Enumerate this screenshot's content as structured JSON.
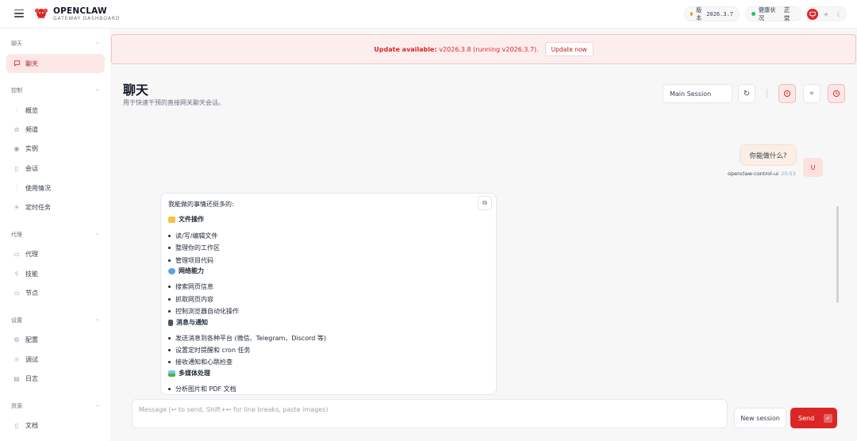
{
  "brand": {
    "name": "OPENCLAW",
    "subtitle": "GATEWAY DASHBOARD"
  },
  "status": {
    "version_label": "版本",
    "version_value": "2026.3.7",
    "health_label": "健康状况",
    "health_value": "正常"
  },
  "colors": {
    "accent": "#dc2626",
    "version_dot": "#f59e0b",
    "health_dot": "#22c55e"
  },
  "sidebar": {
    "groups": [
      {
        "label": "聊天",
        "items": [
          {
            "label": "聊天",
            "icon": "chat-icon",
            "active": true
          }
        ]
      },
      {
        "label": "控制",
        "items": [
          {
            "label": "概览",
            "icon": "bar-chart-icon"
          },
          {
            "label": "频道",
            "icon": "link-icon"
          },
          {
            "label": "实例",
            "icon": "radio-icon"
          },
          {
            "label": "会话",
            "icon": "file-icon"
          },
          {
            "label": "使用情况",
            "icon": "bar-chart-icon"
          },
          {
            "label": "定时任务",
            "icon": "loader-icon"
          }
        ]
      },
      {
        "label": "代理",
        "items": [
          {
            "label": "代理",
            "icon": "folder-icon"
          },
          {
            "label": "技能",
            "icon": "zap-icon"
          },
          {
            "label": "节点",
            "icon": "monitor-icon"
          }
        ]
      },
      {
        "label": "设置",
        "items": [
          {
            "label": "配置",
            "icon": "gear-icon"
          },
          {
            "label": "调试",
            "icon": "bug-icon"
          },
          {
            "label": "日志",
            "icon": "file-text-icon"
          }
        ]
      },
      {
        "label": "资源",
        "items": [
          {
            "label": "文档",
            "icon": "book-icon"
          }
        ]
      }
    ]
  },
  "banner": {
    "title": "Update available:",
    "text": "v2026.3.8 (running v2026.3.7).",
    "button": "Update now"
  },
  "page": {
    "title": "聊天",
    "subtitle": "用于快速干预的直接网关聊天会话。"
  },
  "session_select": "Main Session",
  "messages": {
    "user": {
      "text": "你能做什么?",
      "sender": "openclaw-control-ui",
      "time": "20:53",
      "avatar": "U"
    },
    "assistant": {
      "intro": "我能做的事情还挺多的:",
      "sections": [
        {
          "title": "文件操作",
          "items": [
            "读/写/编辑文件",
            "整理你的工作区",
            "管理项目代码"
          ]
        },
        {
          "title": "网络能力",
          "items": [
            "搜索网页信息",
            "抓取网页内容",
            "控制浏览器自动化操作"
          ]
        },
        {
          "title": "消息与通知",
          "items": [
            "发送消息到各种平台 (微信、Telegram、Discord 等)",
            "设置定时提醒和 cron 任务",
            "接收通知和心跳检查"
          ]
        },
        {
          "title": "多媒体处理",
          "items": [
            "分析图片和 PDF 文档"
          ]
        }
      ]
    }
  },
  "composer": {
    "placeholder": "Message (↩ to send, Shift+↩ for line breaks, paste images)",
    "new_session": "New session",
    "send": "Send"
  }
}
